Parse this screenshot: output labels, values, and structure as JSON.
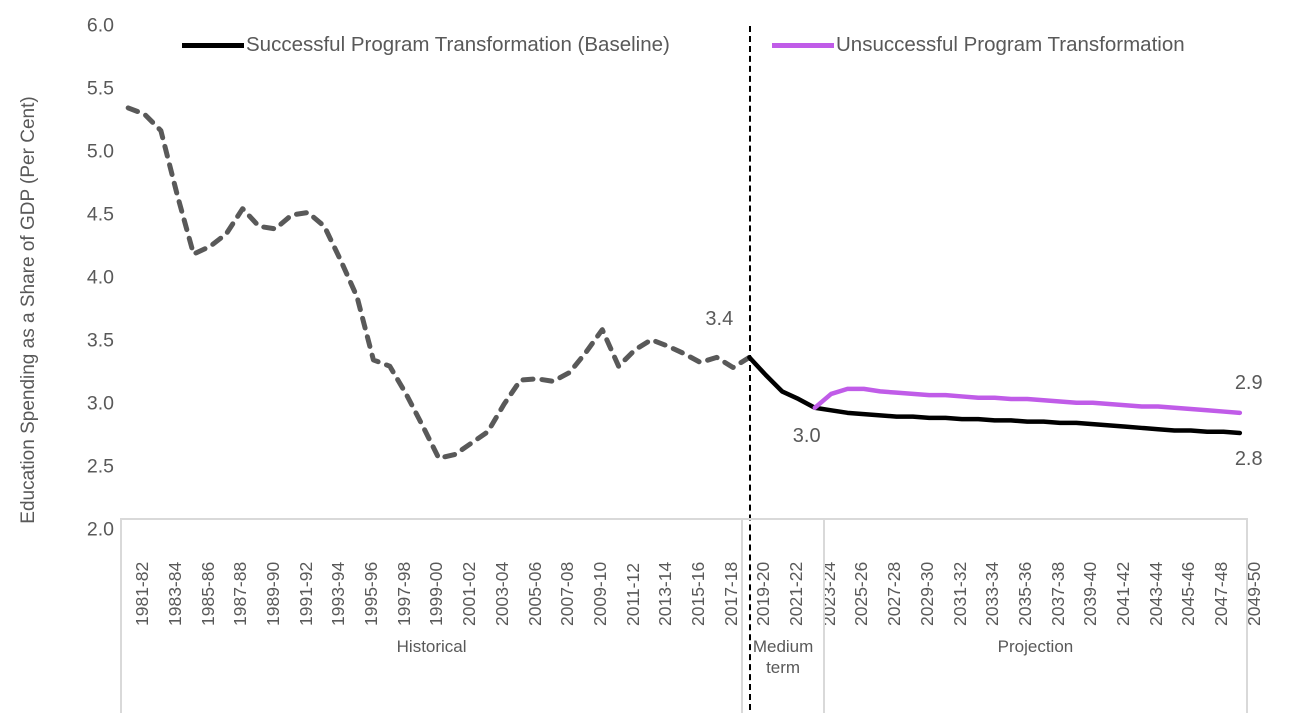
{
  "chart_data": {
    "type": "line",
    "title": "",
    "subtitle": "",
    "xlabel": "",
    "ylabel": "Education Spending as a Share of GDP (Per Cent)",
    "ylim": [
      2.0,
      6.0
    ],
    "ytick_step": 0.5,
    "yticks": [
      "6.0",
      "5.5",
      "5.0",
      "4.5",
      "4.0",
      "3.5",
      "3.0",
      "2.5",
      "2.0"
    ],
    "grid": false,
    "legend_position": "top",
    "legend": [
      {
        "name": "Successful Program Transformation (Baseline)",
        "color": "#000000",
        "style": "solid"
      },
      {
        "name": "Unsuccessful Program Transformation",
        "color": "#c05ce8",
        "style": "solid"
      }
    ],
    "x_tick_labels": [
      "1981-82",
      "1983-84",
      "1985-86",
      "1987-88",
      "1989-90",
      "1991-92",
      "1993-94",
      "1995-96",
      "1997-98",
      "1999-00",
      "2001-02",
      "2003-04",
      "2005-06",
      "2007-08",
      "2009-10",
      "2011-12",
      "2013-14",
      "2015-16",
      "2017-18",
      "2019-20",
      "2021-22",
      "2023-24",
      "2025-26",
      "2027-28",
      "2029-30",
      "2031-32",
      "2033-34",
      "2035-36",
      "2037-38",
      "2039-40",
      "2041-42",
      "2043-44",
      "2045-46",
      "2047-48",
      "2049-50"
    ],
    "x_all_periods": [
      "1981-82",
      "1982-83",
      "1983-84",
      "1984-85",
      "1985-86",
      "1986-87",
      "1987-88",
      "1988-89",
      "1989-90",
      "1990-91",
      "1991-92",
      "1992-93",
      "1993-94",
      "1994-95",
      "1995-96",
      "1996-97",
      "1997-98",
      "1998-99",
      "1999-00",
      "2000-01",
      "2001-02",
      "2002-03",
      "2003-04",
      "2004-05",
      "2005-06",
      "2006-07",
      "2007-08",
      "2008-09",
      "2009-10",
      "2010-11",
      "2011-12",
      "2012-13",
      "2013-14",
      "2014-15",
      "2015-16",
      "2016-17",
      "2017-18",
      "2018-19",
      "2019-20",
      "2020-21",
      "2021-22",
      "2022-23",
      "2023-24",
      "2024-25",
      "2025-26",
      "2026-27",
      "2027-28",
      "2028-29",
      "2029-30",
      "2030-31",
      "2031-32",
      "2032-33",
      "2033-34",
      "2034-35",
      "2035-36",
      "2036-37",
      "2037-38",
      "2038-39",
      "2039-40",
      "2040-41",
      "2041-42",
      "2042-43",
      "2043-44",
      "2044-45",
      "2045-46",
      "2046-47",
      "2047-48",
      "2048-49",
      "2049-50"
    ],
    "series": [
      {
        "name": "Historical",
        "color": "#595959",
        "style": "dashed",
        "x_start": "1981-82",
        "x_end": "2019-20",
        "values": [
          5.35,
          5.3,
          5.17,
          4.66,
          4.19,
          4.25,
          4.35,
          4.55,
          4.41,
          4.39,
          4.5,
          4.52,
          4.41,
          4.14,
          3.85,
          3.35,
          3.3,
          3.08,
          2.83,
          2.57,
          2.6,
          2.69,
          2.78,
          3.0,
          3.19,
          3.2,
          3.18,
          3.25,
          3.41,
          3.59,
          3.3,
          3.43,
          3.51,
          3.46,
          3.4,
          3.33,
          3.37,
          3.29,
          3.37
        ]
      },
      {
        "name": "Successful Program Transformation (Baseline)",
        "color": "#000000",
        "style": "solid",
        "x_start": "2019-20",
        "x_end": "2049-50",
        "values": [
          3.37,
          3.23,
          3.1,
          3.04,
          2.97,
          2.95,
          2.93,
          2.92,
          2.91,
          2.9,
          2.9,
          2.89,
          2.89,
          2.88,
          2.88,
          2.87,
          2.87,
          2.86,
          2.86,
          2.85,
          2.85,
          2.84,
          2.83,
          2.82,
          2.81,
          2.8,
          2.79,
          2.79,
          2.78,
          2.78,
          2.77
        ]
      },
      {
        "name": "Unsuccessful Program Transformation",
        "color": "#c05ce8",
        "style": "solid",
        "x_start": "2023-24",
        "x_end": "2049-50",
        "values": [
          2.97,
          3.08,
          3.12,
          3.12,
          3.1,
          3.09,
          3.08,
          3.07,
          3.07,
          3.06,
          3.05,
          3.05,
          3.04,
          3.04,
          3.03,
          3.02,
          3.01,
          3.01,
          3.0,
          2.99,
          2.98,
          2.98,
          2.97,
          2.96,
          2.95,
          2.94,
          2.93
        ]
      }
    ],
    "annotations": [
      {
        "text": "3.4",
        "series": "Historical",
        "period": "2019-20",
        "value": 3.37
      },
      {
        "text": "3.0",
        "series": "Successful Program Transformation (Baseline)",
        "period": "2023-24",
        "value": 2.97
      },
      {
        "text": "2.9",
        "series": "Unsuccessful Program Transformation",
        "period": "2049-50",
        "value": 2.93
      },
      {
        "text": "2.8",
        "series": "Successful Program Transformation (Baseline)",
        "period": "2049-50",
        "value": 2.77
      }
    ],
    "period_bands": [
      {
        "label": "Historical",
        "start": "1981-82",
        "end": "2018-19"
      },
      {
        "label": "Medium\nterm",
        "start": "2019-20",
        "end": "2023-24"
      },
      {
        "label": "Projection",
        "start": "2024-25",
        "end": "2049-50"
      }
    ],
    "divider": {
      "at": "2019-20",
      "style": "dashed",
      "color": "#000000"
    }
  },
  "legend": {
    "baseline_label": "Successful Program Transformation (Baseline)",
    "unsuccessful_label": "Unsuccessful Program Transformation"
  },
  "axes": {
    "y_title": "Education Spending as a Share of GDP (Per Cent)"
  },
  "bands": {
    "historical": "Historical",
    "medium_term_line1": "Medium",
    "medium_term_line2": "term",
    "projection": "Projection"
  },
  "annotations": {
    "label_3_4": "3.4",
    "label_3_0": "3.0",
    "label_2_9": "2.9",
    "label_2_8": "2.8"
  },
  "colors": {
    "baseline": "#000000",
    "unsuccessful": "#c05ce8",
    "historical": "#595959",
    "text": "#595959",
    "axis_border": "#d9d9d9"
  }
}
